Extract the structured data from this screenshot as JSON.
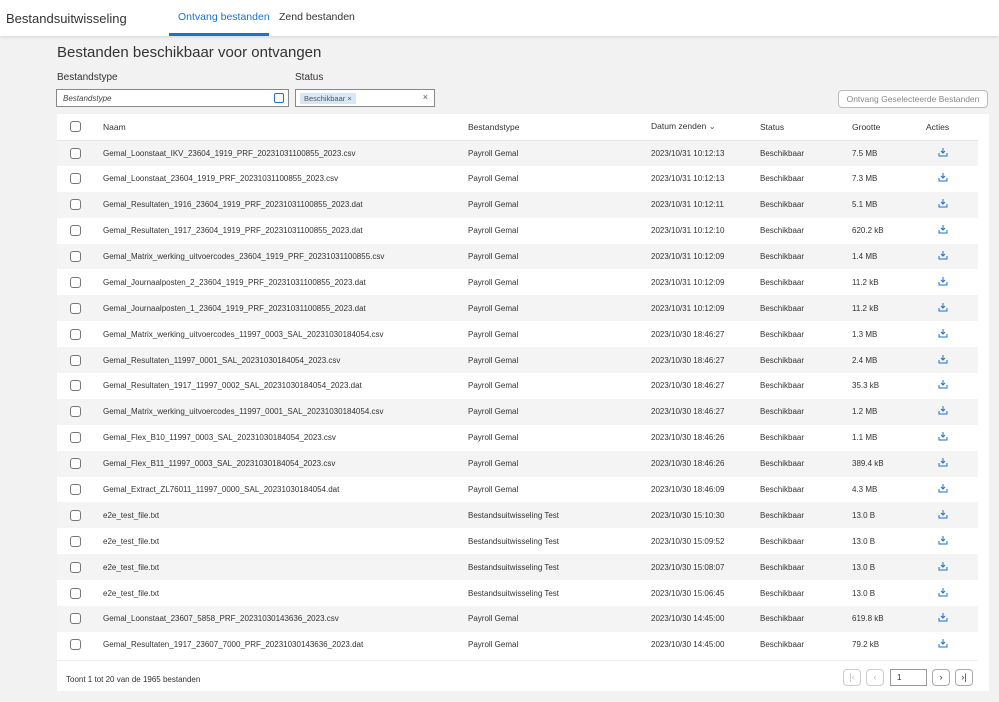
{
  "header": {
    "app_title": "Bestandsuitwisseling",
    "tabs": [
      {
        "label": "Ontvang bestanden",
        "active": true
      },
      {
        "label": "Zend bestanden",
        "active": false
      }
    ]
  },
  "main": {
    "title": "Bestanden beschikbaar voor ontvangen",
    "filters": {
      "type_label": "Bestandstype",
      "type_placeholder": "Bestandstype",
      "status_label": "Status",
      "status_chip": "Beschikbaar",
      "chip_remove": "×",
      "clear": "×"
    },
    "receive_button": "Ontvang Geselecteerde Bestanden",
    "columns": [
      "Naam",
      "Bestandstype",
      "Datum zenden",
      "Status",
      "Grootte",
      "Acties"
    ],
    "sort_icon": "⌄",
    "rows": [
      [
        "Gemal_Loonstaat_IKV_23604_1919_PRF_20231031100855_2023.csv",
        "Payroll Gemal",
        "2023/10/31 10:12:13",
        "Beschikbaar",
        "7.5 MB"
      ],
      [
        "Gemal_Loonstaat_23604_1919_PRF_20231031100855_2023.csv",
        "Payroll Gemal",
        "2023/10/31 10:12:13",
        "Beschikbaar",
        "7.3 MB"
      ],
      [
        "Gemal_Resultaten_1916_23604_1919_PRF_20231031100855_2023.dat",
        "Payroll Gemal",
        "2023/10/31 10:12:11",
        "Beschikbaar",
        "5.1 MB"
      ],
      [
        "Gemal_Resultaten_1917_23604_1919_PRF_20231031100855_2023.dat",
        "Payroll Gemal",
        "2023/10/31 10:12:10",
        "Beschikbaar",
        "620.2 kB"
      ],
      [
        "Gemal_Matrix_werking_uitvoercodes_23604_1919_PRF_20231031100855.csv",
        "Payroll Gemal",
        "2023/10/31 10:12:09",
        "Beschikbaar",
        "1.4 MB"
      ],
      [
        "Gemal_Journaalposten_2_23604_1919_PRF_20231031100855_2023.dat",
        "Payroll Gemal",
        "2023/10/31 10:12:09",
        "Beschikbaar",
        "11.2 kB"
      ],
      [
        "Gemal_Journaalposten_1_23604_1919_PRF_20231031100855_2023.dat",
        "Payroll Gemal",
        "2023/10/31 10:12:09",
        "Beschikbaar",
        "11.2 kB"
      ],
      [
        "Gemal_Matrix_werking_uitvoercodes_11997_0003_SAL_20231030184054.csv",
        "Payroll Gemal",
        "2023/10/30 18:46:27",
        "Beschikbaar",
        "1.3 MB"
      ],
      [
        "Gemal_Resultaten_11997_0001_SAL_20231030184054_2023.csv",
        "Payroll Gemal",
        "2023/10/30 18:46:27",
        "Beschikbaar",
        "2.4 MB"
      ],
      [
        "Gemal_Resultaten_1917_11997_0002_SAL_20231030184054_2023.dat",
        "Payroll Gemal",
        "2023/10/30 18:46:27",
        "Beschikbaar",
        "35.3 kB"
      ],
      [
        "Gemal_Matrix_werking_uitvoercodes_11997_0001_SAL_20231030184054.csv",
        "Payroll Gemal",
        "2023/10/30 18:46:27",
        "Beschikbaar",
        "1.2 MB"
      ],
      [
        "Gemal_Flex_B10_11997_0003_SAL_20231030184054_2023.csv",
        "Payroll Gemal",
        "2023/10/30 18:46:26",
        "Beschikbaar",
        "1.1 MB"
      ],
      [
        "Gemal_Flex_B11_11997_0003_SAL_20231030184054_2023.csv",
        "Payroll Gemal",
        "2023/10/30 18:46:26",
        "Beschikbaar",
        "389.4 kB"
      ],
      [
        "Gemal_Extract_ZL76011_11997_0000_SAL_20231030184054.dat",
        "Payroll Gemal",
        "2023/10/30 18:46:09",
        "Beschikbaar",
        "4.3 MB"
      ],
      [
        "e2e_test_file.txt",
        "Bestandsuitwisseling Test",
        "2023/10/30 15:10:30",
        "Beschikbaar",
        "13.0 B"
      ],
      [
        "e2e_test_file.txt",
        "Bestandsuitwisseling Test",
        "2023/10/30 15:09:52",
        "Beschikbaar",
        "13.0 B"
      ],
      [
        "e2e_test_file.txt",
        "Bestandsuitwisseling Test",
        "2023/10/30 15:08:07",
        "Beschikbaar",
        "13.0 B"
      ],
      [
        "e2e_test_file.txt",
        "Bestandsuitwisseling Test",
        "2023/10/30 15:06:45",
        "Beschikbaar",
        "13.0 B"
      ],
      [
        "Gemal_Loonstaat_23607_5858_PRF_20231030143636_2023.csv",
        "Payroll Gemal",
        "2023/10/30 14:45:00",
        "Beschikbaar",
        "619.8 kB"
      ],
      [
        "Gemal_Resultaten_1917_23607_7000_PRF_20231030143636_2023.dat",
        "Payroll Gemal",
        "2023/10/30 14:45:00",
        "Beschikbaar",
        "79.2 kB"
      ]
    ],
    "footer": {
      "summary": "Toont 1 tot 20 van de 1965 bestanden",
      "page": "1",
      "first": "|‹",
      "prev": "‹",
      "next": "›",
      "last": "›|"
    }
  }
}
